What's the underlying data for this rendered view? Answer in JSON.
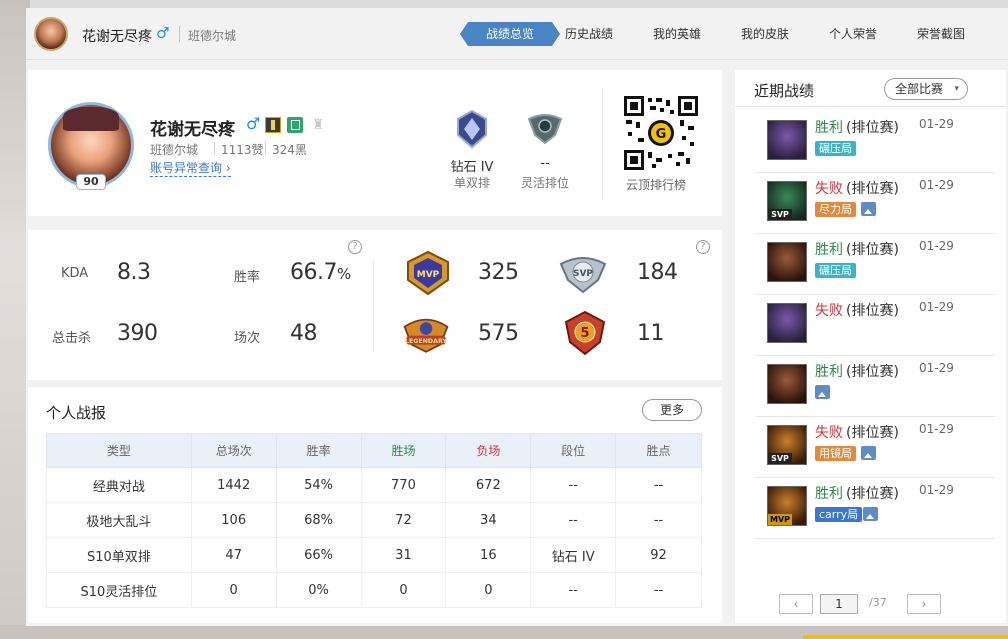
{
  "nav": {
    "name": "花谢无尽疼",
    "gender": "♂",
    "server": "班德尔城",
    "tabs": [
      {
        "label": "战绩总览",
        "active": true
      },
      {
        "label": "历史战绩"
      },
      {
        "label": "我的英雄"
      },
      {
        "label": "我的皮肤"
      },
      {
        "label": "个人荣誉"
      },
      {
        "label": "荣誉截图"
      }
    ]
  },
  "profile": {
    "name": "花谢无尽疼",
    "gender": "♂",
    "level": "90",
    "server": "班德尔城",
    "likes": "1113赞",
    "blacks": "324黑",
    "link": "账号异常查询 ›",
    "ranks": [
      {
        "tier": "钻石 IV",
        "queue": "单双排",
        "icon": "diamond-rank-emblem"
      },
      {
        "tier": "--",
        "queue": "灵活排位",
        "icon": "unranked-rank-emblem"
      }
    ],
    "qr_label": "云顶排行榜"
  },
  "stats": {
    "kda_label": "KDA",
    "kda": "8.3",
    "winrate_label": "胜率",
    "winrate": "66.7",
    "winrate_unit": "%",
    "kills_label": "总击杀",
    "kills": "390",
    "games_label": "场次",
    "games": "48",
    "honors": [
      {
        "name": "MVP",
        "count": "325",
        "color": "#d79a2a"
      },
      {
        "name": "SVP",
        "count": "184",
        "color": "#b9c2cc"
      },
      {
        "name": "LEGENDARY",
        "count": "575",
        "color": "#d58a2a"
      },
      {
        "name": "5",
        "count": "11",
        "color": "#c8402a"
      }
    ]
  },
  "report": {
    "title": "个人战报",
    "more": "更多",
    "headers": [
      "类型",
      "总场次",
      "胜率",
      "胜场",
      "负场",
      "段位",
      "胜点"
    ],
    "rows": [
      [
        "经典对战",
        "1442",
        "54%",
        "770",
        "672",
        "--",
        "--"
      ],
      [
        "极地大乱斗",
        "106",
        "68%",
        "72",
        "34",
        "--",
        "--"
      ],
      [
        "S10单双排",
        "47",
        "66%",
        "31",
        "16",
        "钻石 IV",
        "92"
      ],
      [
        "S10灵活排位",
        "0",
        "0%",
        "0",
        "0",
        "--",
        "--"
      ]
    ]
  },
  "recent": {
    "title": "近期战绩",
    "filter": "全部比赛",
    "matches": [
      {
        "result": "胜利",
        "outcome": "win",
        "type": "(排位赛)",
        "date": "01-29",
        "tag": "碾压局",
        "tag_color": "teal",
        "pic": false,
        "champ_tag": "",
        "colors": [
          "#7a5aa8",
          "#2a1f3e"
        ]
      },
      {
        "result": "失败",
        "outcome": "loss",
        "type": "(排位赛)",
        "date": "01-29",
        "tag": "尽力局",
        "tag_color": "orange",
        "pic": true,
        "champ_tag": "SVP",
        "colors": [
          "#3a8a5a",
          "#142a20"
        ]
      },
      {
        "result": "胜利",
        "outcome": "win",
        "type": "(排位赛)",
        "date": "01-29",
        "tag": "碾压局",
        "tag_color": "teal",
        "pic": false,
        "champ_tag": "",
        "colors": [
          "#9a5a3a",
          "#2a120a"
        ]
      },
      {
        "result": "失败",
        "outcome": "loss",
        "type": "(排位赛)",
        "date": "01-29",
        "tag": "",
        "tag_color": "",
        "pic": false,
        "champ_tag": "",
        "colors": [
          "#7a5aa8",
          "#2a1f3e"
        ]
      },
      {
        "result": "胜利",
        "outcome": "win",
        "type": "(排位赛)",
        "date": "01-29",
        "tag": "",
        "tag_color": "",
        "pic": true,
        "champ_tag": "",
        "colors": [
          "#9a5a3a",
          "#2a120a"
        ]
      },
      {
        "result": "失败",
        "outcome": "loss",
        "type": "(排位赛)",
        "date": "01-29",
        "tag": "用镜局",
        "tag_color": "orange",
        "pic": true,
        "champ_tag": "SVP",
        "colors": [
          "#c8802a",
          "#3a1a08"
        ]
      },
      {
        "result": "胜利",
        "outcome": "win",
        "type": "(排位赛)",
        "date": "01-29",
        "tag": "carry局",
        "tag_color": "blue",
        "pic": true,
        "champ_tag": "MVP",
        "colors": [
          "#c8802a",
          "#3a1a08"
        ]
      }
    ],
    "pager": {
      "prev": "‹",
      "current": "1",
      "total": "/37",
      "next": "›"
    }
  }
}
